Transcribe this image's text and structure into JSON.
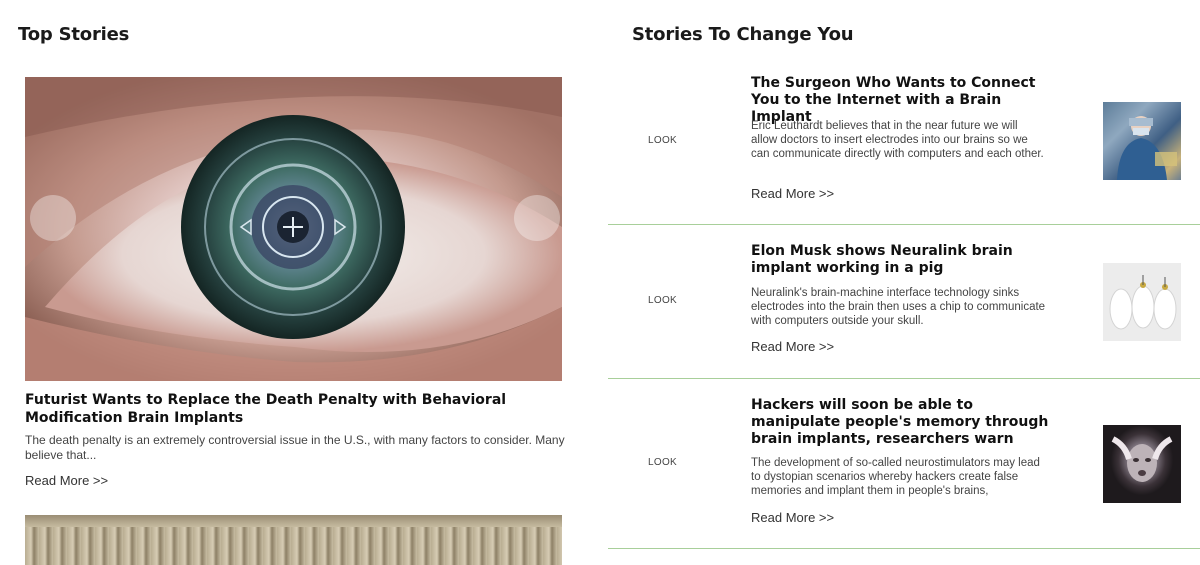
{
  "top_stories": {
    "heading": "Top Stories",
    "featured": {
      "headline": "Futurist Wants to Replace the Death Penalty with Behavioral Modification Brain Implants",
      "excerpt": "The death penalty is an extremely controversial issue in the U.S., with many factors to consider. Many believe that...",
      "read_more": "Read More >>",
      "image": "cyber-eye-image"
    }
  },
  "stories_to_change": {
    "heading": "Stories To Change You",
    "items": [
      {
        "tag": "LOOK",
        "title": "The Surgeon Who Wants to Connect You to the Internet with a Brain Implant",
        "excerpt": "Eric Leuthardt believes that in the near future we will allow doctors to insert electrodes into our brains so we can communicate directly with computers and each other.",
        "read_more": "Read More >>",
        "thumb": "surgeon-thumbnail"
      },
      {
        "tag": "LOOK",
        "title": "Elon Musk shows Neuralink brain implant working in a pig",
        "excerpt": "Neuralink's brain-machine interface technology sinks electrodes into the brain then uses a chip to communicate with computers outside your skull.",
        "read_more": "Read More >>",
        "thumb": "pigs-thumbnail"
      },
      {
        "tag": "LOOK",
        "title": "Hackers will soon be able to manipulate people's memory through brain implants, researchers warn",
        "excerpt": "The development of so-called neurostimulators may lead to dystopian scenarios whereby hackers create false memories and implant them in people's brains,",
        "read_more": "Read More >>",
        "thumb": "distressed-person-thumbnail"
      }
    ]
  },
  "colors": {
    "divider": "#a8cf9a",
    "text": "#111111"
  }
}
